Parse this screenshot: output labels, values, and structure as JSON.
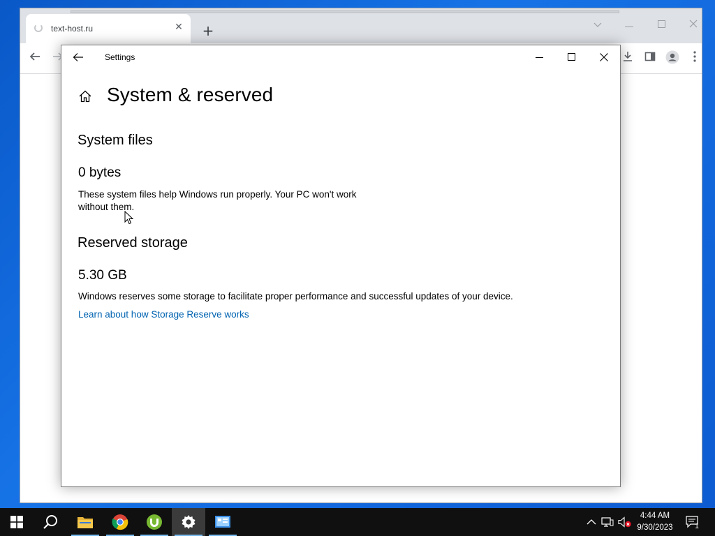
{
  "browser": {
    "tab_title": "text-host.ru"
  },
  "settings": {
    "app_title": "Settings",
    "page_title": "System & reserved",
    "system_files": {
      "heading": "System files",
      "size": "0 bytes",
      "description_line1": "These system files help Windows run properly. Your PC won't work",
      "description_line2": "without them."
    },
    "reserved_storage": {
      "heading": "Reserved storage",
      "size": "5.30 GB",
      "description": "Windows reserves some storage to facilitate proper performance and successful updates of your device.",
      "link": "Learn about how Storage Reserve works"
    }
  },
  "taskbar": {
    "apps": [
      "start-icon",
      "search-icon",
      "file-explorer-icon",
      "chrome-icon",
      "utorrent-icon",
      "settings-icon",
      "control-panel-icon"
    ],
    "active_app": "settings-icon",
    "time": "4:44 AM",
    "date": "9/30/2023",
    "notification_count": "1"
  },
  "colors": {
    "desktop": "#0a58c8",
    "taskbar": "#101010",
    "link": "#0063b1",
    "active_underline": "#76b9ed"
  }
}
